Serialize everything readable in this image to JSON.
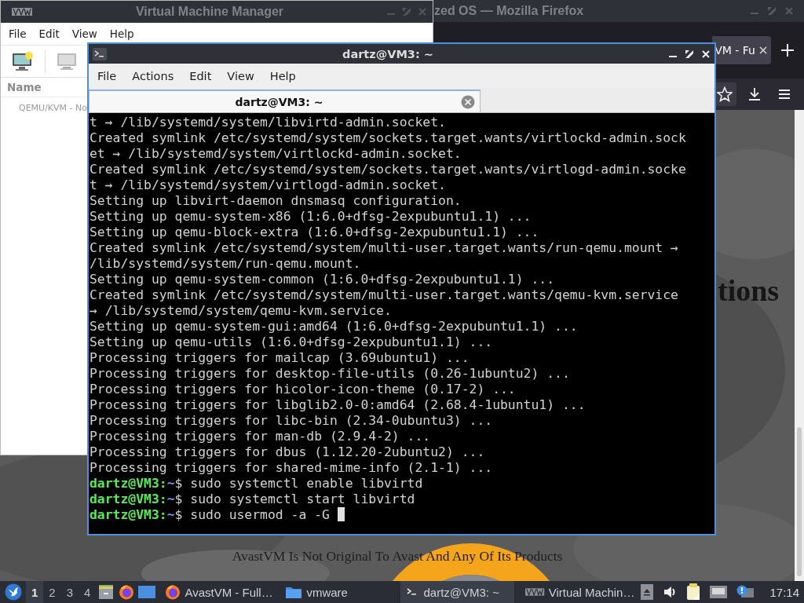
{
  "browser_window": {
    "title": "zed OS — Mozilla Firefox",
    "tabs": [
      {
        "label": "VM - Fu",
        "selected": true
      }
    ],
    "page": {
      "heading": "tions",
      "footer": "AvastVM Is Not Original To Avast And Any Of Its Products"
    }
  },
  "vmm_window": {
    "title": "Virtual Machine Manager",
    "menu": [
      "File",
      "Edit",
      "View",
      "Help"
    ],
    "column": "Name",
    "connections": [
      "QEMU/KVM - No"
    ]
  },
  "terminal_window": {
    "title": "dartz@VM3: ~",
    "menu": [
      "File",
      "Actions",
      "Edit",
      "View",
      "Help"
    ],
    "tabs": [
      {
        "label": "dartz@VM3: ~",
        "selected": true
      }
    ],
    "lines": [
      {
        "kind": "output",
        "text": "t → /lib/systemd/system/libvirtd-admin.socket."
      },
      {
        "kind": "output",
        "text": "Created symlink /etc/systemd/system/sockets.target.wants/virtlockd-admin.sock"
      },
      {
        "kind": "output",
        "text": "et → /lib/systemd/system/virtlockd-admin.socket."
      },
      {
        "kind": "output",
        "text": "Created symlink /etc/systemd/system/sockets.target.wants/virtlogd-admin.socke"
      },
      {
        "kind": "output",
        "text": "t → /lib/systemd/system/virtlogd-admin.socket."
      },
      {
        "kind": "output",
        "text": "Setting up libvirt-daemon dnsmasq configuration."
      },
      {
        "kind": "output",
        "text": "Setting up qemu-system-x86 (1:6.0+dfsg-2expubuntu1.1) ..."
      },
      {
        "kind": "output",
        "text": "Setting up qemu-block-extra (1:6.0+dfsg-2expubuntu1.1) ..."
      },
      {
        "kind": "output",
        "text": "Created symlink /etc/systemd/system/multi-user.target.wants/run-qemu.mount →"
      },
      {
        "kind": "output",
        "text": "/lib/systemd/system/run-qemu.mount."
      },
      {
        "kind": "output",
        "text": "Setting up qemu-system-common (1:6.0+dfsg-2expubuntu1.1) ..."
      },
      {
        "kind": "output",
        "text": "Created symlink /etc/systemd/system/multi-user.target.wants/qemu-kvm.service"
      },
      {
        "kind": "output",
        "text": "→ /lib/systemd/system/qemu-kvm.service."
      },
      {
        "kind": "output",
        "text": "Setting up qemu-system-gui:amd64 (1:6.0+dfsg-2expubuntu1.1) ..."
      },
      {
        "kind": "output",
        "text": "Setting up qemu-utils (1:6.0+dfsg-2expubuntu1.1) ..."
      },
      {
        "kind": "output",
        "text": "Processing triggers for mailcap (3.69ubuntu1) ..."
      },
      {
        "kind": "output",
        "text": "Processing triggers for desktop-file-utils (0.26-1ubuntu2) ..."
      },
      {
        "kind": "output",
        "text": "Processing triggers for hicolor-icon-theme (0.17-2) ..."
      },
      {
        "kind": "output",
        "text": "Processing triggers for libglib2.0-0:amd64 (2.68.4-1ubuntu1) ..."
      },
      {
        "kind": "output",
        "text": "Processing triggers for libc-bin (2.34-0ubuntu3) ..."
      },
      {
        "kind": "output",
        "text": "Processing triggers for man-db (2.9.4-2) ..."
      },
      {
        "kind": "output",
        "text": "Processing triggers for dbus (1.12.20-2ubuntu2) ..."
      },
      {
        "kind": "output",
        "text": "Processing triggers for shared-mime-info (2.1-1) ..."
      },
      {
        "kind": "prompt",
        "user": "dartz@VM3:",
        "path": "~",
        "sign": "$",
        "command": "sudo systemctl enable libvirtd",
        "cursor": false
      },
      {
        "kind": "prompt",
        "user": "dartz@VM3:",
        "path": "~",
        "sign": "$",
        "command": "sudo systemctl start libvirtd",
        "cursor": false
      },
      {
        "kind": "prompt",
        "user": "dartz@VM3:",
        "path": "~",
        "sign": "$",
        "command": "sudo usermod -a -G",
        "cursor": true
      }
    ]
  },
  "taskbar": {
    "workspaces": [
      {
        "label": "1",
        "selected": true
      },
      {
        "label": "2",
        "selected": false
      },
      {
        "label": "3",
        "selected": false
      },
      {
        "label": "4",
        "selected": false
      }
    ],
    "tasks": [
      {
        "label": "AvastVM - Full…",
        "kind": "browser",
        "selected": false
      },
      {
        "label": "vmware",
        "kind": "folder",
        "selected": false
      },
      {
        "label": "dartz@VM3: ~",
        "kind": "terminal",
        "selected": true
      },
      {
        "label": "Virtual Machin…",
        "kind": "manager",
        "selected": false
      }
    ],
    "clock": "17:14"
  }
}
